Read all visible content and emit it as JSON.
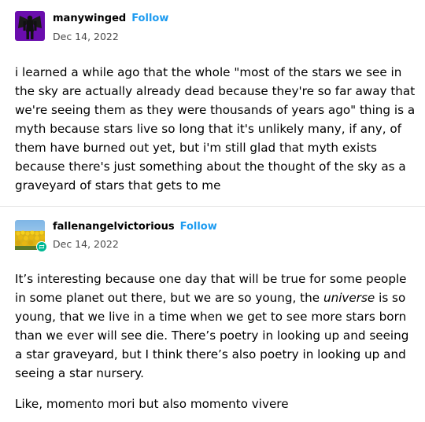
{
  "posts": [
    {
      "username": "manywinged",
      "follow_label": "Follow",
      "date": "Dec 14, 2022",
      "avatar_icon": "dark-winged-figure-avatar",
      "body": "i learned a while ago that the whole \"most of the stars we see in the sky are actually already dead because they're so far away that we're seeing them as they were thousands of years ago\" thing is a myth because stars live so long that it's unlikely many, if any, of them have burned out yet, but i'm still glad that myth exists because there's just something about the thought of the sky as a graveyard of stars that gets to me"
    },
    {
      "username": "fallenangelvictorious",
      "follow_label": "Follow",
      "date": "Dec 14, 2022",
      "avatar_icon": "sunflower-field-avatar",
      "badge_icon": "reblog-badge-icon",
      "paragraph1_before": "It’s interesting because one day that will be true for some people in some planet out there, but we are so young, the ",
      "paragraph1_em": "universe",
      "paragraph1_after": " is so young, that we live in a time when we get to see more stars born than we ever will see die. There’s poetry in looking up and seeing a star graveyard, but I think there’s also poetry in looking up and seeing a star nursery.",
      "paragraph2": "Like, momento mori but also momento vivere"
    }
  ],
  "colors": {
    "follow": "#1d9bf0",
    "divider": "#e3e3e3",
    "avatar1_bg": "#6a0dad",
    "badge": "#00b894"
  }
}
